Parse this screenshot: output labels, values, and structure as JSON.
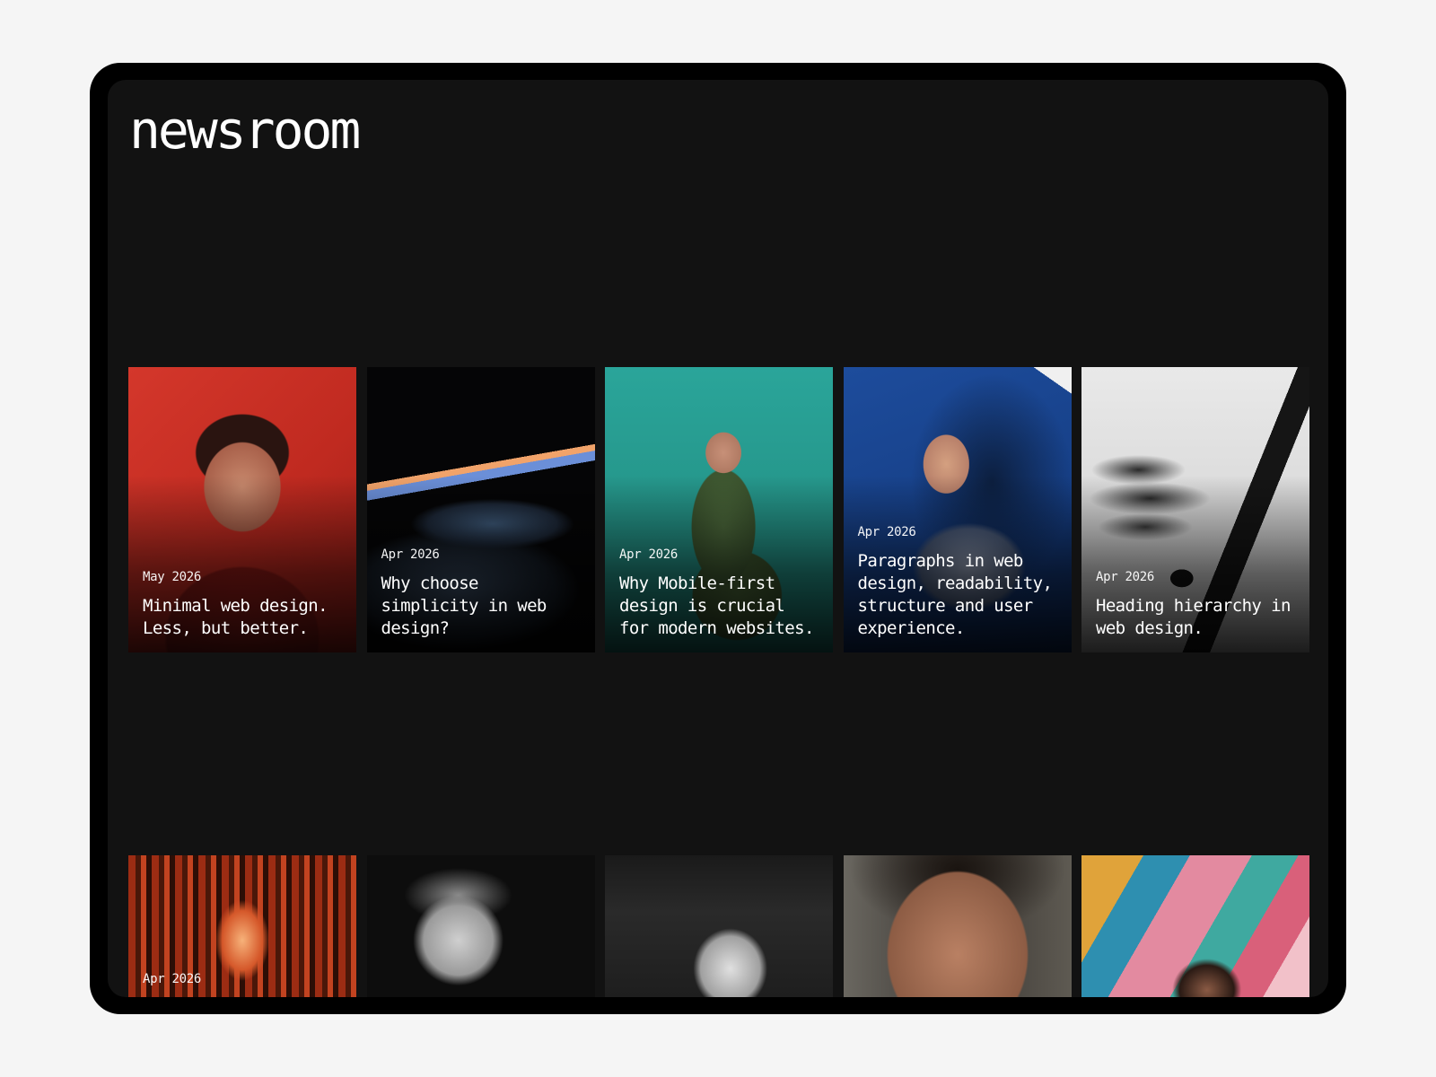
{
  "site": {
    "title": "newsroom"
  },
  "articles_row_1": [
    {
      "date": "May 2026",
      "title": "Minimal web design. Less, but better.",
      "image": "woman-heart-glasses-red"
    },
    {
      "date": "Apr 2026",
      "title": "Why choose simplicity in web design?",
      "image": "laptop-dark"
    },
    {
      "date": "Apr 2026",
      "title": "Why Mobile-first design is crucial for modern websites.",
      "image": "woman-phone-teal"
    },
    {
      "date": "Apr 2026",
      "title": "Paragraphs in web design, readability, structure and user experience.",
      "image": "woman-blue"
    },
    {
      "date": "Apr 2026",
      "title": "Heading hierarchy in web design.",
      "image": "ink-brush"
    }
  ],
  "articles_row_2": [
    {
      "date": "Apr 2026",
      "image": "torii-gates"
    },
    {
      "date": "",
      "image": "marble-statue"
    },
    {
      "date": "",
      "image": "woman-hair-bw"
    },
    {
      "date": "",
      "image": "woman-face-closeup"
    },
    {
      "date": "",
      "image": "woman-mural"
    }
  ]
}
